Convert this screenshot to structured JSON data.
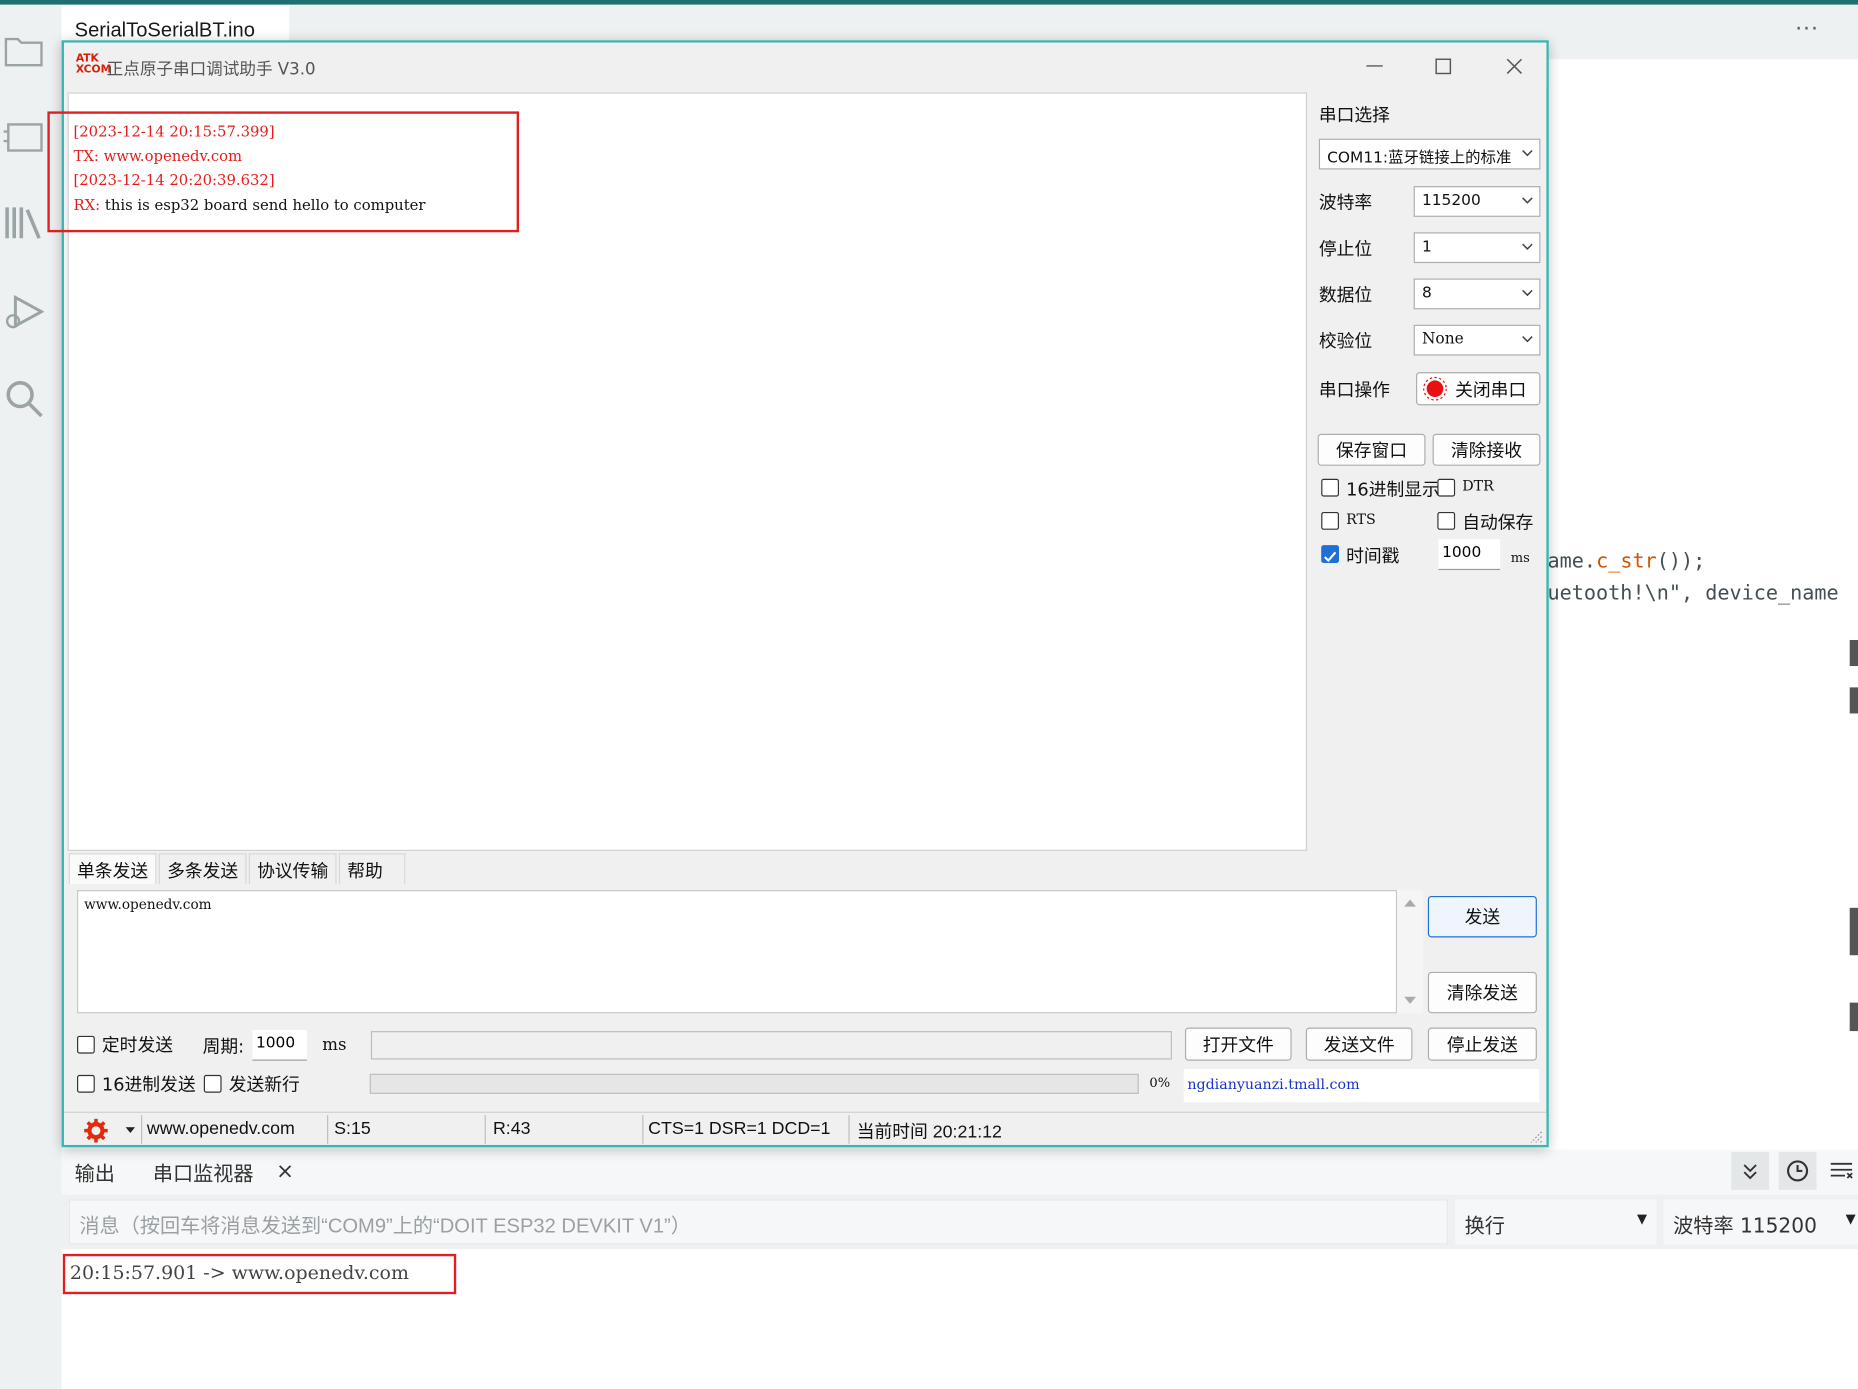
{
  "ide": {
    "file_tab": "SerialToSerialBT.ino",
    "more": "···",
    "code_line1_prefix": "ame.",
    "code_line1_fn": "c_str",
    "code_line1_suffix": "());",
    "code_line2": "uetooth!\\n\", device_name"
  },
  "window": {
    "logo": "ATK XCOM",
    "title": "正点原子串口调试助手 V3.0"
  },
  "receive": {
    "lines": [
      {
        "text": "[2023-12-14 20:15:57.399]",
        "color": "#e51c1c"
      },
      {
        "prefix": "TX: ",
        "text": "www.openedv.com",
        "color": "#e51c1c"
      },
      {
        "text": "[2023-12-14 20:20:39.632]",
        "color": "#e51c1c"
      },
      {
        "prefix": "RX: ",
        "text": "this is esp32 board send hello to computer",
        "color": "#111111"
      }
    ]
  },
  "settings": {
    "port_label": "串口选择",
    "port_value": "COM11:蓝牙链接上的标准",
    "baud_label": "波特率",
    "baud_value": "115200",
    "stop_label": "停止位",
    "stop_value": "1",
    "data_label": "数据位",
    "data_value": "8",
    "parity_label": "校验位",
    "parity_value": "None",
    "op_label": "串口操作",
    "op_button": "关闭串口",
    "save_window": "保存窗口",
    "clear_recv": "清除接收",
    "hex_display": "16进制显示",
    "dtr": "DTR",
    "rts": "RTS",
    "auto_save": "自动保存",
    "timestamp": "时间戳",
    "timestamp_value": "1000",
    "timestamp_unit": "ms"
  },
  "tabs": [
    "单条发送",
    "多条发送",
    "协议传输",
    "帮助"
  ],
  "send": {
    "text": "www.openedv.com",
    "send_button": "发送",
    "clear_send": "清除发送",
    "timed_send": "定时发送",
    "period_label": "周期:",
    "period_value": "1000",
    "period_unit": "ms",
    "open_file": "打开文件",
    "send_file": "发送文件",
    "stop_send": "停止发送",
    "hex_send": "16进制发送",
    "send_newline": "发送新行",
    "progress": "0%",
    "link": "ngdianyuanzi.tmall.com"
  },
  "status": {
    "website": "www.openedv.com",
    "sent": "S:15",
    "received": "R:43",
    "lines": "CTS=1 DSR=1 DCD=1",
    "time": "当前时间 20:21:12"
  },
  "monitor": {
    "tab_output": "输出",
    "tab_serial": "串口监视器",
    "close": "×",
    "input_placeholder": "消息（按回车将消息发送到“COM9”上的“DOIT ESP32 DEVKIT V1”）",
    "line_ending": "换行",
    "baud": "波特率 115200",
    "output_line": "20:15:57.901 -> www.openedv.com"
  },
  "colors": {
    "accent": "#1f6f70",
    "window_border": "#3ab5b5",
    "highlight": "#e02020",
    "tx_red": "#e51c1c",
    "link_blue": "#1a33cc"
  }
}
